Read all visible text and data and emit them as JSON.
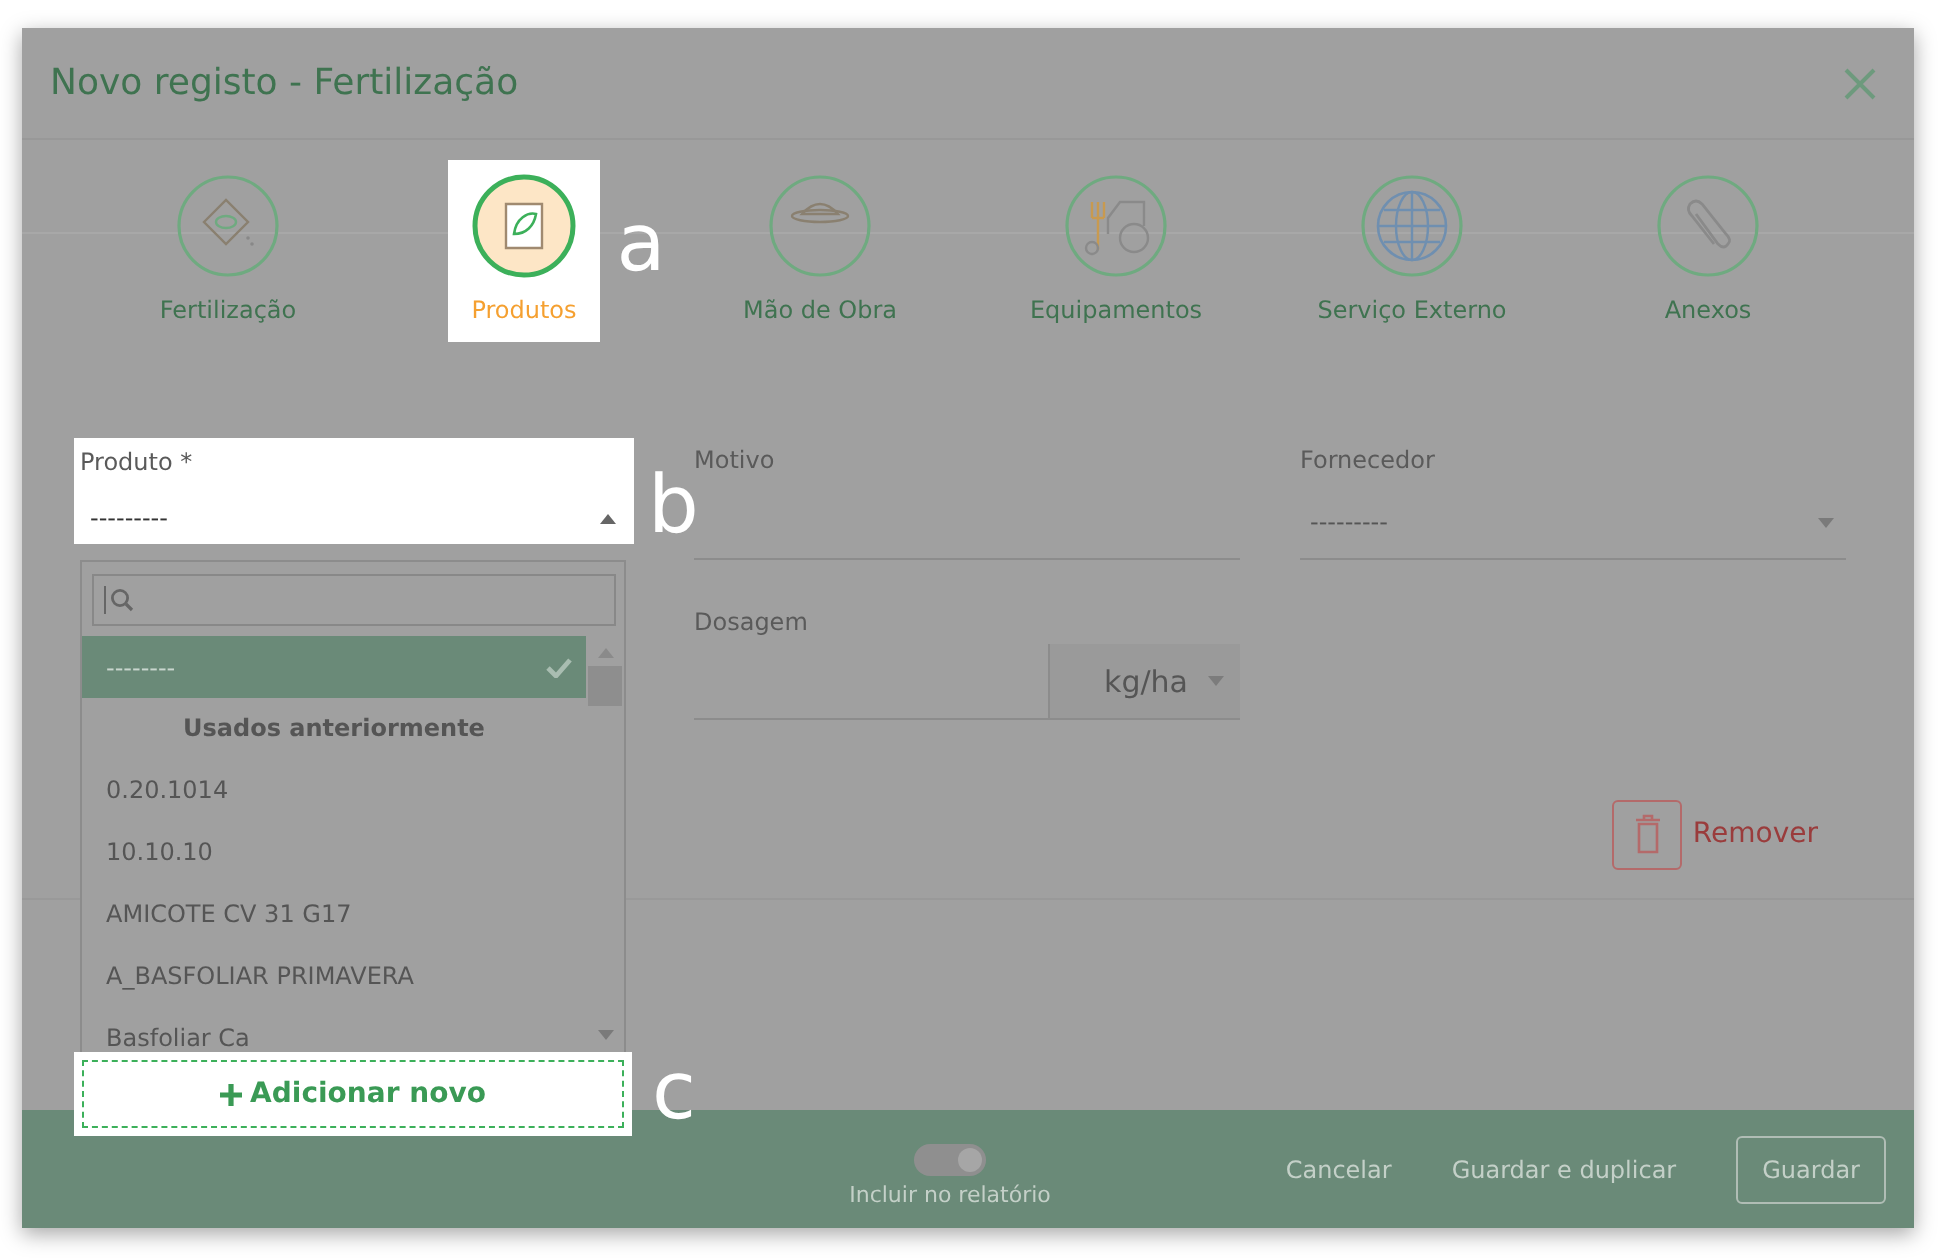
{
  "dialog": {
    "title": "Novo registo - Fertilização"
  },
  "steps": [
    {
      "label": "Fertilização",
      "selected": false,
      "highlighted": false
    },
    {
      "label": "Produtos",
      "selected": true,
      "highlighted": true,
      "callout": "a"
    },
    {
      "label": "Mão de Obra",
      "selected": false,
      "highlighted": false
    },
    {
      "label": "Equipamentos",
      "selected": false,
      "highlighted": false
    },
    {
      "label": "Serviço Externo",
      "selected": false,
      "highlighted": false
    },
    {
      "label": "Anexos",
      "selected": false,
      "highlighted": false
    }
  ],
  "form": {
    "produto": {
      "label": "Produto *",
      "value": "---------",
      "highlighted": true,
      "open": true,
      "callout": "b"
    },
    "motivo": {
      "label": "Motivo"
    },
    "fornecedor": {
      "label": "Fornecedor",
      "value": "---------"
    },
    "dosagem": {
      "label": "Dosagem",
      "unit": "kg/ha"
    },
    "remove_button": "Remover"
  },
  "dropdown": {
    "options": [
      {
        "label": "--------",
        "selected": true
      }
    ],
    "group": "Usados anteriormente",
    "items": [
      {
        "label": "0.20.1014",
        "selected": false
      },
      {
        "label": "10.10.10",
        "selected": false
      },
      {
        "label": "AMICOTE CV 31 G17",
        "selected": false
      },
      {
        "label": "A_BASFOLIAR PRIMAVERA",
        "selected": false
      },
      {
        "label": "Basfoliar Ca",
        "selected": false
      }
    ],
    "add_button": {
      "label": "Adicionar novo",
      "highlighted": true,
      "callout": "c"
    }
  },
  "footer": {
    "toggle": {
      "label": "Incluir no relatório",
      "on": true
    },
    "buttons": [
      {
        "label": "Cancelar",
        "kind": "text"
      },
      {
        "label": "Guardar e duplicar",
        "kind": "text"
      },
      {
        "label": "Guardar",
        "kind": "outlined"
      }
    ]
  }
}
